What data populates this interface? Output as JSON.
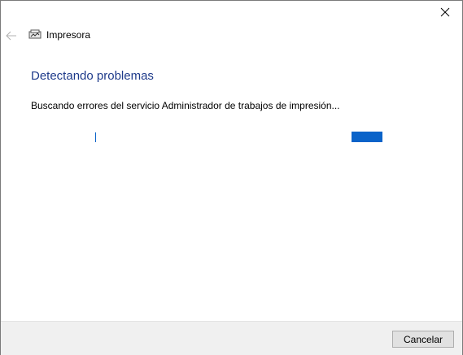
{
  "window": {
    "title": "Impresora"
  },
  "main": {
    "heading": "Detectando problemas",
    "status": "Buscando errores del servicio Administrador de trabajos de impresión..."
  },
  "footer": {
    "cancel_label": "Cancelar"
  },
  "icons": {
    "close": "close-icon",
    "back": "back-arrow-icon",
    "app": "printer-icon"
  },
  "colors": {
    "heading": "#1e3a8a",
    "progress": "#0a63c9"
  }
}
